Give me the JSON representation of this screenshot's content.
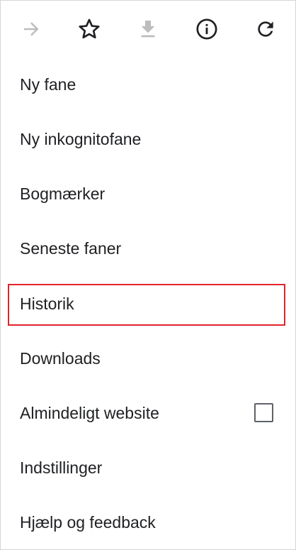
{
  "toolbar": {
    "forward_icon": "arrow-forward-icon",
    "bookmark_icon": "star-outline-icon",
    "download_icon": "download-icon",
    "info_icon": "info-icon",
    "reload_icon": "reload-icon",
    "icon_color": "#202124",
    "disabled_icon_color": "#bdbdbd"
  },
  "menu": {
    "items": [
      {
        "label": "Ny fane"
      },
      {
        "label": "Ny inkognitofane"
      },
      {
        "label": "Bogmærker"
      },
      {
        "label": "Seneste faner"
      },
      {
        "label": "Historik"
      },
      {
        "label": "Downloads"
      },
      {
        "label": "Almindeligt website",
        "checked": false
      },
      {
        "label": "Indstillinger"
      },
      {
        "label": "Hjælp og feedback"
      }
    ],
    "highlighted_item": "Historik",
    "highlight_color": "#e3232c"
  }
}
